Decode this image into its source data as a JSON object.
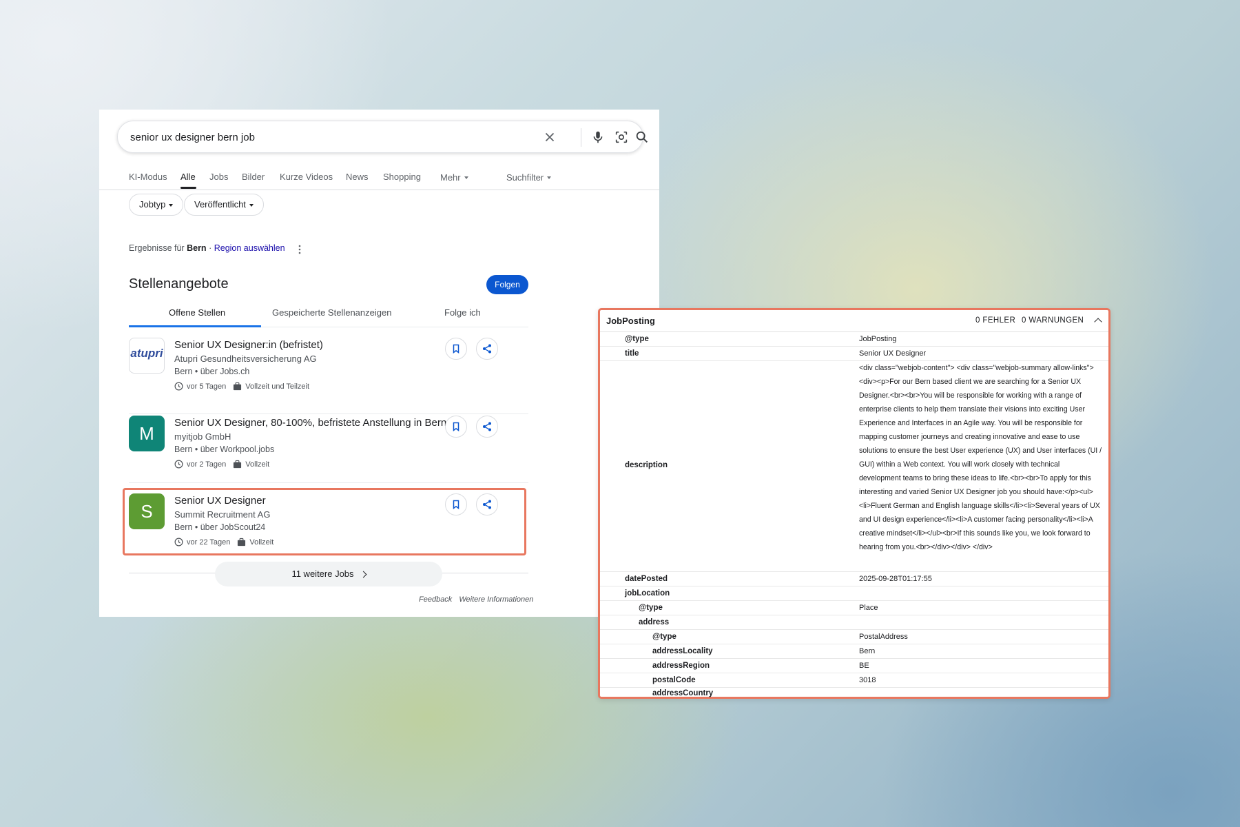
{
  "search": {
    "query": "senior ux designer bern job",
    "icons": [
      "close-icon",
      "microphone-icon",
      "lens-icon",
      "search-icon"
    ]
  },
  "tabs": [
    "KI-Modus",
    "Alle",
    "Jobs",
    "Bilder",
    "Kurze Videos",
    "News",
    "Shopping",
    "Mehr",
    "Suchfilter"
  ],
  "filters": [
    "Jobtyp",
    "Veröffentlicht"
  ],
  "region": {
    "prefix": "Ergebnisse für",
    "place": "Bern",
    "separator": "·",
    "link": "Region auswählen"
  },
  "jobs_panel": {
    "title": "Stellenangebote",
    "follow_label": "Folgen",
    "tabs": [
      "Offene Stellen",
      "Gespeicherte Stellenanzeigen",
      "Folge ich"
    ],
    "jobs": [
      {
        "logo": "atupri",
        "title": "Senior UX Designer:in (befristet)",
        "company": "Atupri Gesundheitsversicherung AG",
        "source": "Bern • über Jobs.ch",
        "age": "vor 5 Tagen",
        "type": "Vollzeit und Teilzeit"
      },
      {
        "logo": "M",
        "logo_color": "#0f8577",
        "title": "Senior UX Designer, 80-100%, befristete Anstellung in Bern",
        "company": "myitjob GmbH",
        "source": "Bern • über Workpool.jobs",
        "age": "vor 2 Tagen",
        "type": "Vollzeit"
      },
      {
        "logo": "S",
        "logo_color": "#5d9c33",
        "title": "Senior UX Designer",
        "company": "Summit Recruitment AG",
        "source": "Bern • über JobScout24",
        "age": "vor 22 Tagen",
        "type": "Vollzeit"
      }
    ],
    "more_label": "11 weitere Jobs",
    "feedback": "Feedback",
    "more_info": "Weitere Informationen"
  },
  "structured_data": {
    "title": "JobPosting",
    "errors": "0 FEHLER",
    "warnings": "0 WARNUNGEN",
    "rows": [
      {
        "key": "@type",
        "value": "JobPosting"
      },
      {
        "key": "title",
        "value": "Senior UX Designer"
      },
      {
        "key": "description",
        "value": "<div class=\"webjob-content\"> <div class=\"webjob-summary allow-links\"><div><p>For our Bern based client we are searching for a Senior UX Designer.<br><br>You will be responsible for working with a range of enterprise clients to help them translate their visions into exciting User Experience and Interfaces in an Agile way. You will be responsible for mapping customer journeys and creating innovative and ease to use solutions to ensure the best User experience (UX) and User interfaces (UI / GUI) within a Web context. You will work closely with technical development teams to bring these ideas to life.<br><br>To apply for this interesting and varied Senior UX Designer job you should have:</p><ul><li>Fluent German and English language skills</li><li>Several years of UX and UI design experience</li><li>A customer facing personality</li><li>A creative mindset</li></ul><br>If this sounds like you, we look forward to hearing from you.<br></div></div> </div>"
      },
      {
        "key": "datePosted",
        "value": "2025-09-28T01:17:55"
      },
      {
        "key": "jobLocation",
        "value": ""
      },
      {
        "key": "@type",
        "value": "Place"
      },
      {
        "key": "address",
        "value": ""
      },
      {
        "key": "@type",
        "value": "PostalAddress"
      },
      {
        "key": "addressLocality",
        "value": "Bern"
      },
      {
        "key": "addressRegion",
        "value": "BE"
      },
      {
        "key": "postalCode",
        "value": "3018"
      },
      {
        "key": "addressCountry",
        "value": ""
      }
    ]
  },
  "colors": {
    "accent_blue": "#0b57d0",
    "highlight": "#e8775f",
    "link": "#1a0dab"
  }
}
